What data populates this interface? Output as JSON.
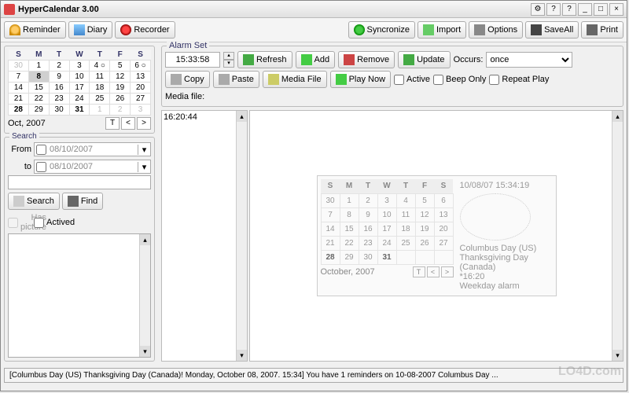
{
  "app": {
    "title": "HyperCalendar 3.00"
  },
  "winbtns": {
    "b1": "⚙",
    "b2": "?",
    "b3": "?",
    "min": "_",
    "max": "□",
    "close": "×"
  },
  "toolbar": {
    "reminder": "Reminder",
    "diary": "Diary",
    "recorder": "Recorder",
    "sync": "Syncronize",
    "import": "Import",
    "options": "Options",
    "saveall": "SaveAll",
    "print": "Print"
  },
  "minical": {
    "month": "Oct, 2007",
    "dow": [
      "S",
      "M",
      "T",
      "W",
      "T",
      "F",
      "S"
    ],
    "rows": [
      [
        "30",
        "1",
        "2",
        "3",
        "4 ○",
        "5",
        "6 ○"
      ],
      [
        "7",
        "8",
        "9",
        "10",
        "11",
        "12",
        "13"
      ],
      [
        "14",
        "15",
        "16",
        "17",
        "18",
        "19",
        "20"
      ],
      [
        "21",
        "22",
        "23",
        "24",
        "25",
        "26",
        "27"
      ],
      [
        "28",
        "29",
        "30",
        "31",
        "1",
        "2",
        "3"
      ]
    ],
    "nav": {
      "t": "T",
      "prev": "<",
      "next": ">"
    }
  },
  "search": {
    "legend": "Search",
    "from_label": "From",
    "to_label": "to",
    "from": "08/10/2007",
    "to": "08/10/2007",
    "search_btn": "Search",
    "find_btn": "Find",
    "has_picture": "Has picture",
    "actived": "Actived"
  },
  "alarmset": {
    "legend": "Alarm Set",
    "time": "15:33:58",
    "refresh": "Refresh",
    "add": "Add",
    "remove": "Remove",
    "update": "Update",
    "occurs_label": "Occurs:",
    "occurs_value": "once",
    "copy": "Copy",
    "paste": "Paste",
    "mediafile_btn": "Media File",
    "playnow": "Play Now",
    "active": "Active",
    "beeponly": "Beep Only",
    "repeatplay": "Repeat Play",
    "mediafile_label": "Media file:"
  },
  "timecol": {
    "time": "16:20:44"
  },
  "preview": {
    "datetime": "10/08/07 15:34:19",
    "month": "October, 2007",
    "dow": [
      "S",
      "M",
      "T",
      "W",
      "T",
      "F",
      "S"
    ],
    "rows": [
      [
        "30",
        "1",
        "2",
        "3",
        "4",
        "5",
        "6"
      ],
      [
        "7",
        "8",
        "9",
        "10",
        "11",
        "12",
        "13"
      ],
      [
        "14",
        "15",
        "16",
        "17",
        "18",
        "19",
        "20"
      ],
      [
        "21",
        "22",
        "23",
        "24",
        "25",
        "26",
        "27"
      ],
      [
        "28",
        "29",
        "30",
        "31",
        "",
        "",
        ""
      ]
    ],
    "info": "Columbus Day (US)\nThanksgiving Day (Canada)\n*16:20\nWeekday alarm",
    "nav": {
      "t": "T",
      "prev": "<",
      "next": ">"
    }
  },
  "statusbar": "[Columbus Day (US) Thanksgiving Day (Canada)! Monday, October 08, 2007. 15:34] You have 1 reminders on 10-08-2007 Columbus Day ...",
  "watermark": "LO4D.com"
}
